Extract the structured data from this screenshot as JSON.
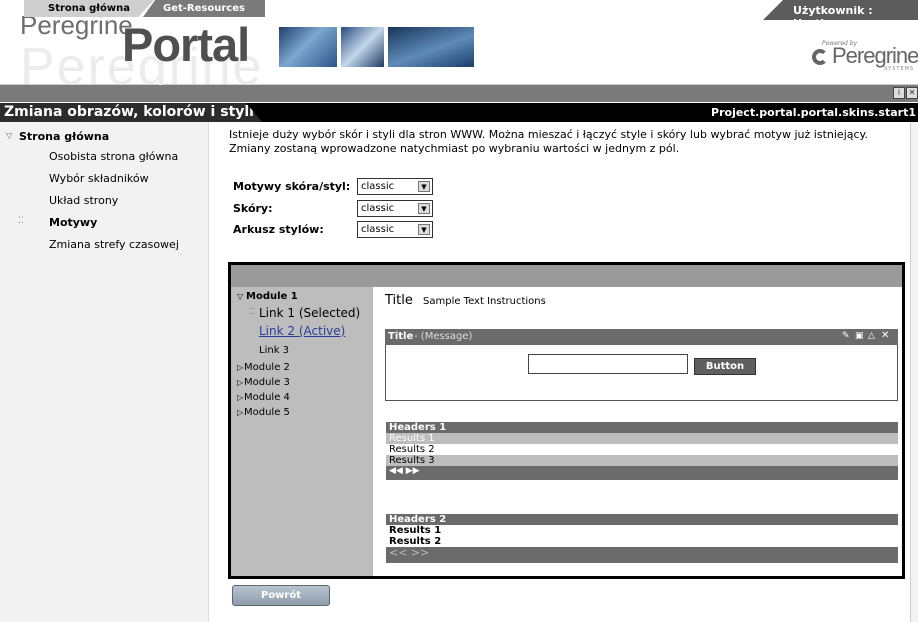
{
  "header": {
    "logo_word1": "Peregrine",
    "logo_word2": "Portal",
    "logo_ghost": "Peregrine",
    "user_label": "Użytkownik : Hartke",
    "powered_by": "Powered by",
    "peregrine_brand": "Peregrine",
    "peregrine_systems": "SYSTEMS"
  },
  "tabs": {
    "home": "Strona główna",
    "get_resources": "Get-Resources"
  },
  "titlebar": {
    "title": "Zmiana obrazów, kolorów i styli",
    "project": "Project.portal.portal.skins.start1"
  },
  "sidebar": {
    "section": "Strona główna",
    "items": [
      "Osobista strona główna",
      "Wybór składników",
      "Układ strony",
      "Motywy",
      "Zmiana strefy czasowej"
    ]
  },
  "intro_text": "Istnieje duży wybór skór i styli dla stron WWW. Można mieszać i łączyć style i skóry lub wybrać motyw już istniejący. Zmiany zostaną wprowadzone natychmiast po wybraniu wartości w jednym z pól.",
  "form": {
    "theme_label": "Motywy skóra/styl:",
    "theme_value": "classic",
    "skins_label": "Skóry:",
    "skins_value": "classic",
    "sheet_label": "Arkusz stylów:",
    "sheet_value": "classic"
  },
  "preview": {
    "nav": {
      "module1": "Module 1",
      "link1": "Link 1 (Selected)",
      "link2": "Link 2 (Active)",
      "link3": "Link 3",
      "module2": "Module 2",
      "module3": "Module 3",
      "module4": "Module 4",
      "module5": "Module 5"
    },
    "title_word": "Title",
    "title_sub": "Sample Text Instructions",
    "portlet_title": "Title",
    "portlet_message": "- (Message)",
    "button": "Button",
    "table1": {
      "header": "Headers 1",
      "rows": [
        "Results 1",
        "Results 2",
        "Results 3"
      ],
      "pager": "◀◀ ▶▶"
    },
    "table2": {
      "header": "Headers 2",
      "rows": [
        "Results 1",
        "Results 2"
      ],
      "pager": "<< >>"
    }
  },
  "back_button": "Powrót"
}
